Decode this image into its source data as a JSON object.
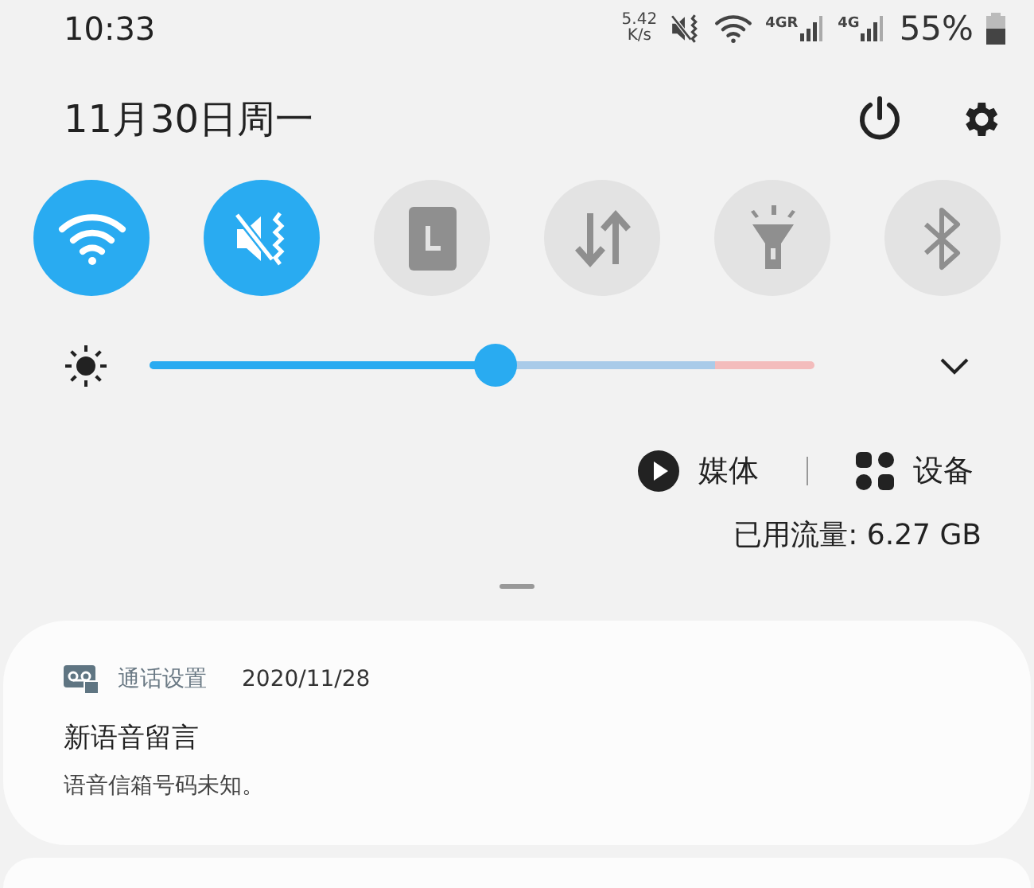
{
  "status_bar": {
    "time": "10:33",
    "net_speed": [
      "5.42",
      "K/s"
    ],
    "signals": [
      {
        "label": "4GR"
      },
      {
        "label": "4G"
      }
    ],
    "battery": "55%"
  },
  "header": {
    "date": "11月30日周一"
  },
  "toggles": [
    {
      "kind": "wifi",
      "on": true
    },
    {
      "kind": "mute",
      "on": true
    },
    {
      "kind": "screen",
      "on": false
    },
    {
      "kind": "data",
      "on": false
    },
    {
      "kind": "flashlight",
      "on": false
    },
    {
      "kind": "bluetooth",
      "on": false
    }
  ],
  "brightness": {
    "level": 0.52
  },
  "media_row": {
    "media": "媒体",
    "devices": "设备"
  },
  "data_usage": "已用流量: 6.27 GB",
  "notifications": [
    {
      "app": "通话设置",
      "date": "2020/11/28",
      "title": "新语音留言",
      "body": "语音信箱号码未知。"
    }
  ]
}
